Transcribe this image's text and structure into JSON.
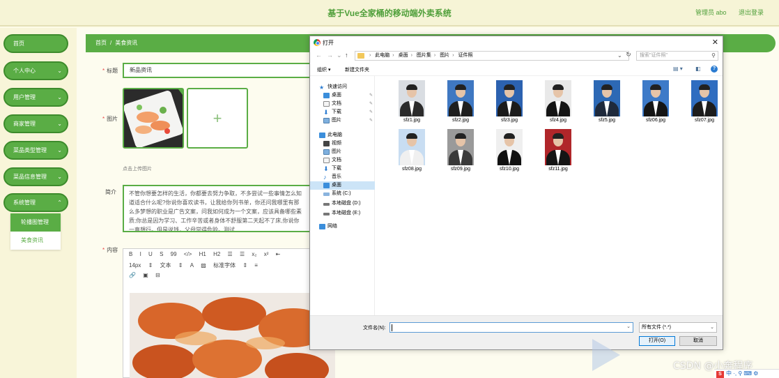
{
  "header": {
    "app_title": "基于Vue全家桶的移动端外卖系统",
    "admin_label": "管理员 abo",
    "logout": "退出登录"
  },
  "sidebar": {
    "items": [
      {
        "label": "首页",
        "has_chevron": false
      },
      {
        "label": "个人中心",
        "has_chevron": true
      },
      {
        "label": "用户管理",
        "has_chevron": true
      },
      {
        "label": "商家管理",
        "has_chevron": true
      },
      {
        "label": "菜品类型管理",
        "has_chevron": true
      },
      {
        "label": "菜品信息管理",
        "has_chevron": true
      },
      {
        "label": "系统管理",
        "has_chevron": true
      }
    ],
    "submenu": [
      {
        "label": "轮播图管理",
        "active": true
      },
      {
        "label": "美食资讯",
        "active": false
      }
    ]
  },
  "breadcrumb": {
    "home": "首页",
    "separator": "/",
    "current": "美食资讯"
  },
  "form": {
    "title_label": "标题",
    "title_value": "新品资讯",
    "image_label": "图片",
    "upload_hint": "点击上传图片",
    "intro_label": "简介",
    "intro_text": "不管你想要怎样的生活，你都要去努力争取，不多尝试一些事情怎么知道适合什么呢?你说你喜欢读书，让我给你列书单，你还问我哪里有那么多梦想的职业是广告文案，问我如何成为一个文案，应该具备哪些素质;你总是因为学习、工作辛苦或者身体不舒服第二天起不了床,你说你一直想行。但是说钱，父母觉得危险。测试",
    "content_label": "内容",
    "toolbar_row1": [
      "B",
      "I",
      "U",
      "S",
      "99",
      "</>",
      "H1",
      "H2",
      "☰",
      "☰",
      "x₂",
      "x²",
      "⇤"
    ],
    "toolbar_row2": [
      "14px",
      "⇕",
      "文本",
      "⇕",
      "A",
      "▨",
      "标准字体",
      "⇕",
      "≡"
    ],
    "toolbar_row3": [
      "🔗",
      "▣",
      "⊟"
    ]
  },
  "dialog": {
    "title": "打开",
    "address": [
      "此电脑",
      "桌面",
      "图片集",
      "图片",
      "证件照"
    ],
    "search_placeholder": "搜索\"证件照\"",
    "organize": "组织 ▾",
    "new_folder": "新建文件夹",
    "nav": [
      {
        "label": "快速访问",
        "indent": 0,
        "icon": "star",
        "pinned": false,
        "selected": false
      },
      {
        "label": "桌面",
        "indent": 1,
        "icon": "desktop",
        "pinned": true,
        "selected": false
      },
      {
        "label": "文档",
        "indent": 1,
        "icon": "doc",
        "pinned": true,
        "selected": false
      },
      {
        "label": "下载",
        "indent": 1,
        "icon": "download",
        "pinned": true,
        "selected": false
      },
      {
        "label": "图片",
        "indent": 1,
        "icon": "picture",
        "pinned": true,
        "selected": false
      },
      {
        "label": "此电脑",
        "indent": 0,
        "icon": "pc",
        "pinned": false,
        "selected": false
      },
      {
        "label": "视频",
        "indent": 1,
        "icon": "video",
        "pinned": false,
        "selected": false
      },
      {
        "label": "图片",
        "indent": 1,
        "icon": "picture",
        "pinned": false,
        "selected": false
      },
      {
        "label": "文档",
        "indent": 1,
        "icon": "doc",
        "pinned": false,
        "selected": false
      },
      {
        "label": "下载",
        "indent": 1,
        "icon": "download",
        "pinned": false,
        "selected": false
      },
      {
        "label": "音乐",
        "indent": 1,
        "icon": "music",
        "pinned": false,
        "selected": false
      },
      {
        "label": "桌面",
        "indent": 1,
        "icon": "desktop",
        "pinned": false,
        "selected": true
      },
      {
        "label": "系统 (C:)",
        "indent": 1,
        "icon": "drive",
        "pinned": false,
        "selected": false
      },
      {
        "label": "本地磁盘 (D:)",
        "indent": 1,
        "icon": "drive",
        "pinned": false,
        "selected": false
      },
      {
        "label": "本地磁盘 (E:)",
        "indent": 1,
        "icon": "drive",
        "pinned": false,
        "selected": false
      },
      {
        "label": "网络",
        "indent": 0,
        "icon": "network",
        "pinned": false,
        "selected": false
      }
    ],
    "files": [
      {
        "name": "sfz1.jpg",
        "bg": "#d9dde2",
        "suit": "#2b2b2b"
      },
      {
        "name": "sfz2.jpg",
        "bg": "#3f78c2",
        "suit": "#1f1f1f"
      },
      {
        "name": "sfz3.jpg",
        "bg": "#2c62b0",
        "suit": "#1b1b1b"
      },
      {
        "name": "sfz4.jpg",
        "bg": "#e9e9e9",
        "suit": "#151515"
      },
      {
        "name": "sfz5.jpg",
        "bg": "#2d69b5",
        "suit": "#1f2a3c"
      },
      {
        "name": "sfz06.jpg",
        "bg": "#3d7ac8",
        "suit": "#151515"
      },
      {
        "name": "sfz07.jpg",
        "bg": "#2f6dc0",
        "suit": "#1d1d1d"
      },
      {
        "name": "sfz08.jpg",
        "bg": "#c8ddf2",
        "suit": "#f0f0f0"
      },
      {
        "name": "sfz09.jpg",
        "bg": "#9a9a9a",
        "suit": "#3a3a3a"
      },
      {
        "name": "sfz10.jpg",
        "bg": "#efefef",
        "suit": "#111111"
      },
      {
        "name": "sfz11.jpg",
        "bg": "#b0262a",
        "suit": "#151515"
      }
    ],
    "filename_label": "文件名(N):",
    "filename_value": "",
    "filter": "所有文件 (*.*)",
    "open_btn": "打开(O)",
    "cancel_btn": "取消"
  },
  "overlay": {
    "watermark": "CSDN @小奔程序",
    "tray_text": "中 ·, ⚲ ⌨ ⚙"
  },
  "colors": {
    "accent": "#5aad45",
    "accent_dark": "#3d8b2c",
    "header_bg": "#f6f4d6"
  }
}
